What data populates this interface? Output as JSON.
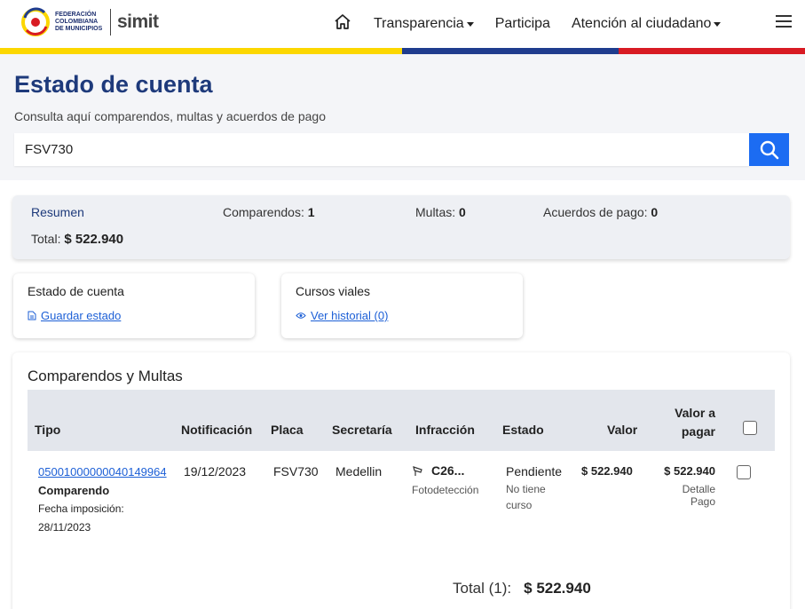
{
  "header": {
    "logo_text_1": "FEDERACIÓN",
    "logo_text_2": "COLOMBIANA",
    "logo_text_3": "DE MUNICIPIOS",
    "logo_simit": "simit",
    "nav": {
      "transparencia": "Transparencia",
      "participa": "Participa",
      "atencion": "Atención al ciudadano"
    }
  },
  "hero": {
    "title": "Estado de cuenta",
    "subtitle": "Consulta aquí comparendos, multas y acuerdos de pago",
    "search_value": "FSV730"
  },
  "summary": {
    "title": "Resumen",
    "comparendos_label": "Comparendos:",
    "comparendos_value": "1",
    "multas_label": "Multas:",
    "multas_value": "0",
    "acuerdos_label": "Acuerdos de pago:",
    "acuerdos_value": "0",
    "total_label": "Total:",
    "total_value": "$ 522.940"
  },
  "cards": {
    "estado": {
      "title": "Estado de cuenta",
      "link": "Guardar estado"
    },
    "cursos": {
      "title": "Cursos viales",
      "link": "Ver historial (0)"
    }
  },
  "table": {
    "title": "Comparendos y Multas",
    "headers": {
      "tipo": "Tipo",
      "notificacion": "Notificación",
      "placa": "Placa",
      "secretaria": "Secretaría",
      "infraccion": "Infracción",
      "estado": "Estado",
      "valor": "Valor",
      "valor_pagar_1": "Valor a",
      "valor_pagar_2": "pagar"
    },
    "row": {
      "numero": "05001000000040149964",
      "tipo": "Comparendo",
      "fecha_label": "Fecha imposición:",
      "fecha": "28/11/2023",
      "notificacion": "19/12/2023",
      "placa": "FSV730",
      "secretaria": "Medellin",
      "infraccion": "C26...",
      "infraccion_sub": "Fotodetección",
      "estado": "Pendiente",
      "estado_sub_1": "No tiene",
      "estado_sub_2": "curso",
      "valor": "$ 522.940",
      "valor_pagar": "$ 522.940",
      "detalle_1": "Detalle",
      "detalle_2": "Pago"
    },
    "total_label": "Total (1):",
    "total_value": "$ 522.940"
  },
  "colors": {
    "primary_blue": "#1e3a7b",
    "search_button": "#1c6cf2",
    "stripe_yellow": "#fcd700",
    "stripe_blue": "#1f3c8e",
    "stripe_red": "#d81b23"
  }
}
